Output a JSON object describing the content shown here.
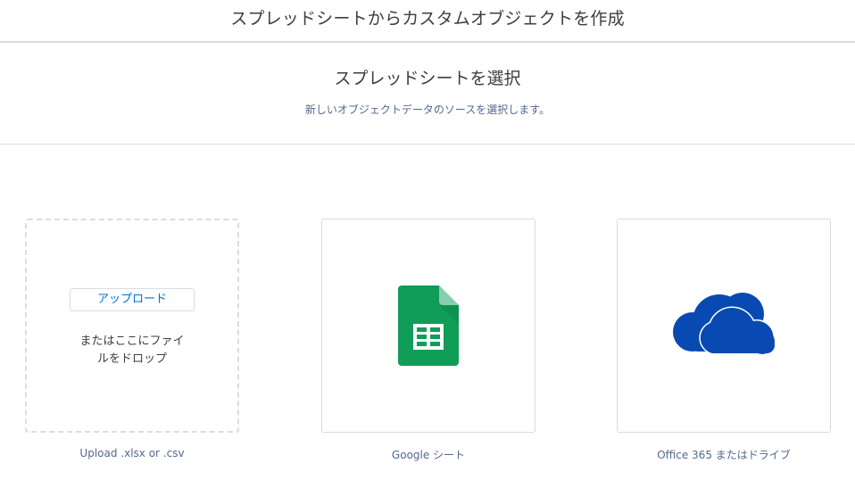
{
  "header": {
    "title": "スプレッドシートからカスタムオブジェクトを作成"
  },
  "section": {
    "title": "スプレッドシートを選択",
    "subtitle": "新しいオブジェクトデータのソースを選択します。"
  },
  "cards": {
    "upload": {
      "button_label": "アップロード",
      "drop_text_line1": "またはここにファイ",
      "drop_text_line2": "ルをドロップ",
      "caption": "Upload .xlsx or .csv"
    },
    "google": {
      "caption": "Google シート",
      "icon": "google-sheets-icon"
    },
    "office": {
      "caption": "Office 365 またはドライブ",
      "icon": "onedrive-cloud-icon"
    }
  },
  "colors": {
    "accent": "#0070d2",
    "sheets_green": "#0f9d58",
    "sheets_fold": "#87ceac",
    "onedrive_blue": "#094ab2"
  }
}
